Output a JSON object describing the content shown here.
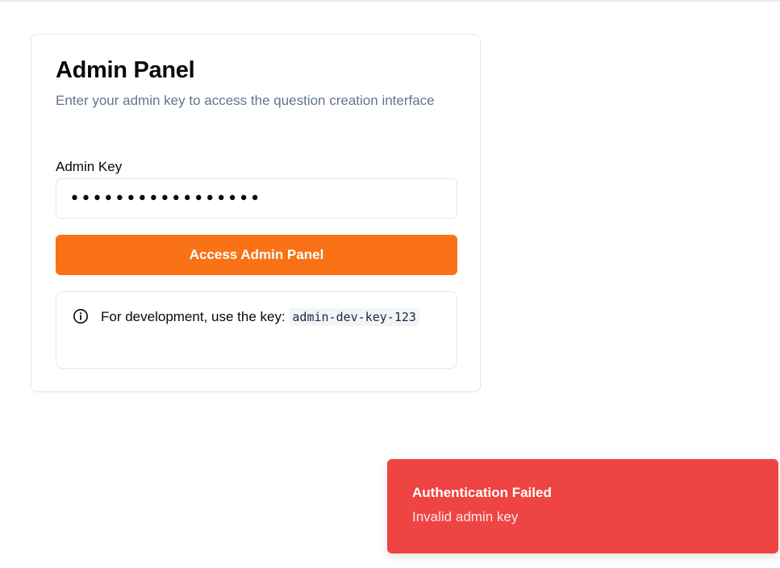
{
  "admin_panel": {
    "title": "Admin Panel",
    "description": "Enter your admin key to access the question creation interface",
    "field_label": "Admin Key",
    "key_value": "•••••••••••••••••",
    "submit_label": "Access Admin Panel",
    "info": {
      "icon": "info-icon",
      "text": "For development, use the key: ",
      "code": "admin-dev-key-123"
    }
  },
  "toast": {
    "title": "Authentication Failed",
    "description": "Invalid admin key"
  },
  "colors": {
    "accent": "#f97316",
    "error": "#ef4444",
    "muted_text": "#64748b",
    "border": "#e5e7eb"
  }
}
